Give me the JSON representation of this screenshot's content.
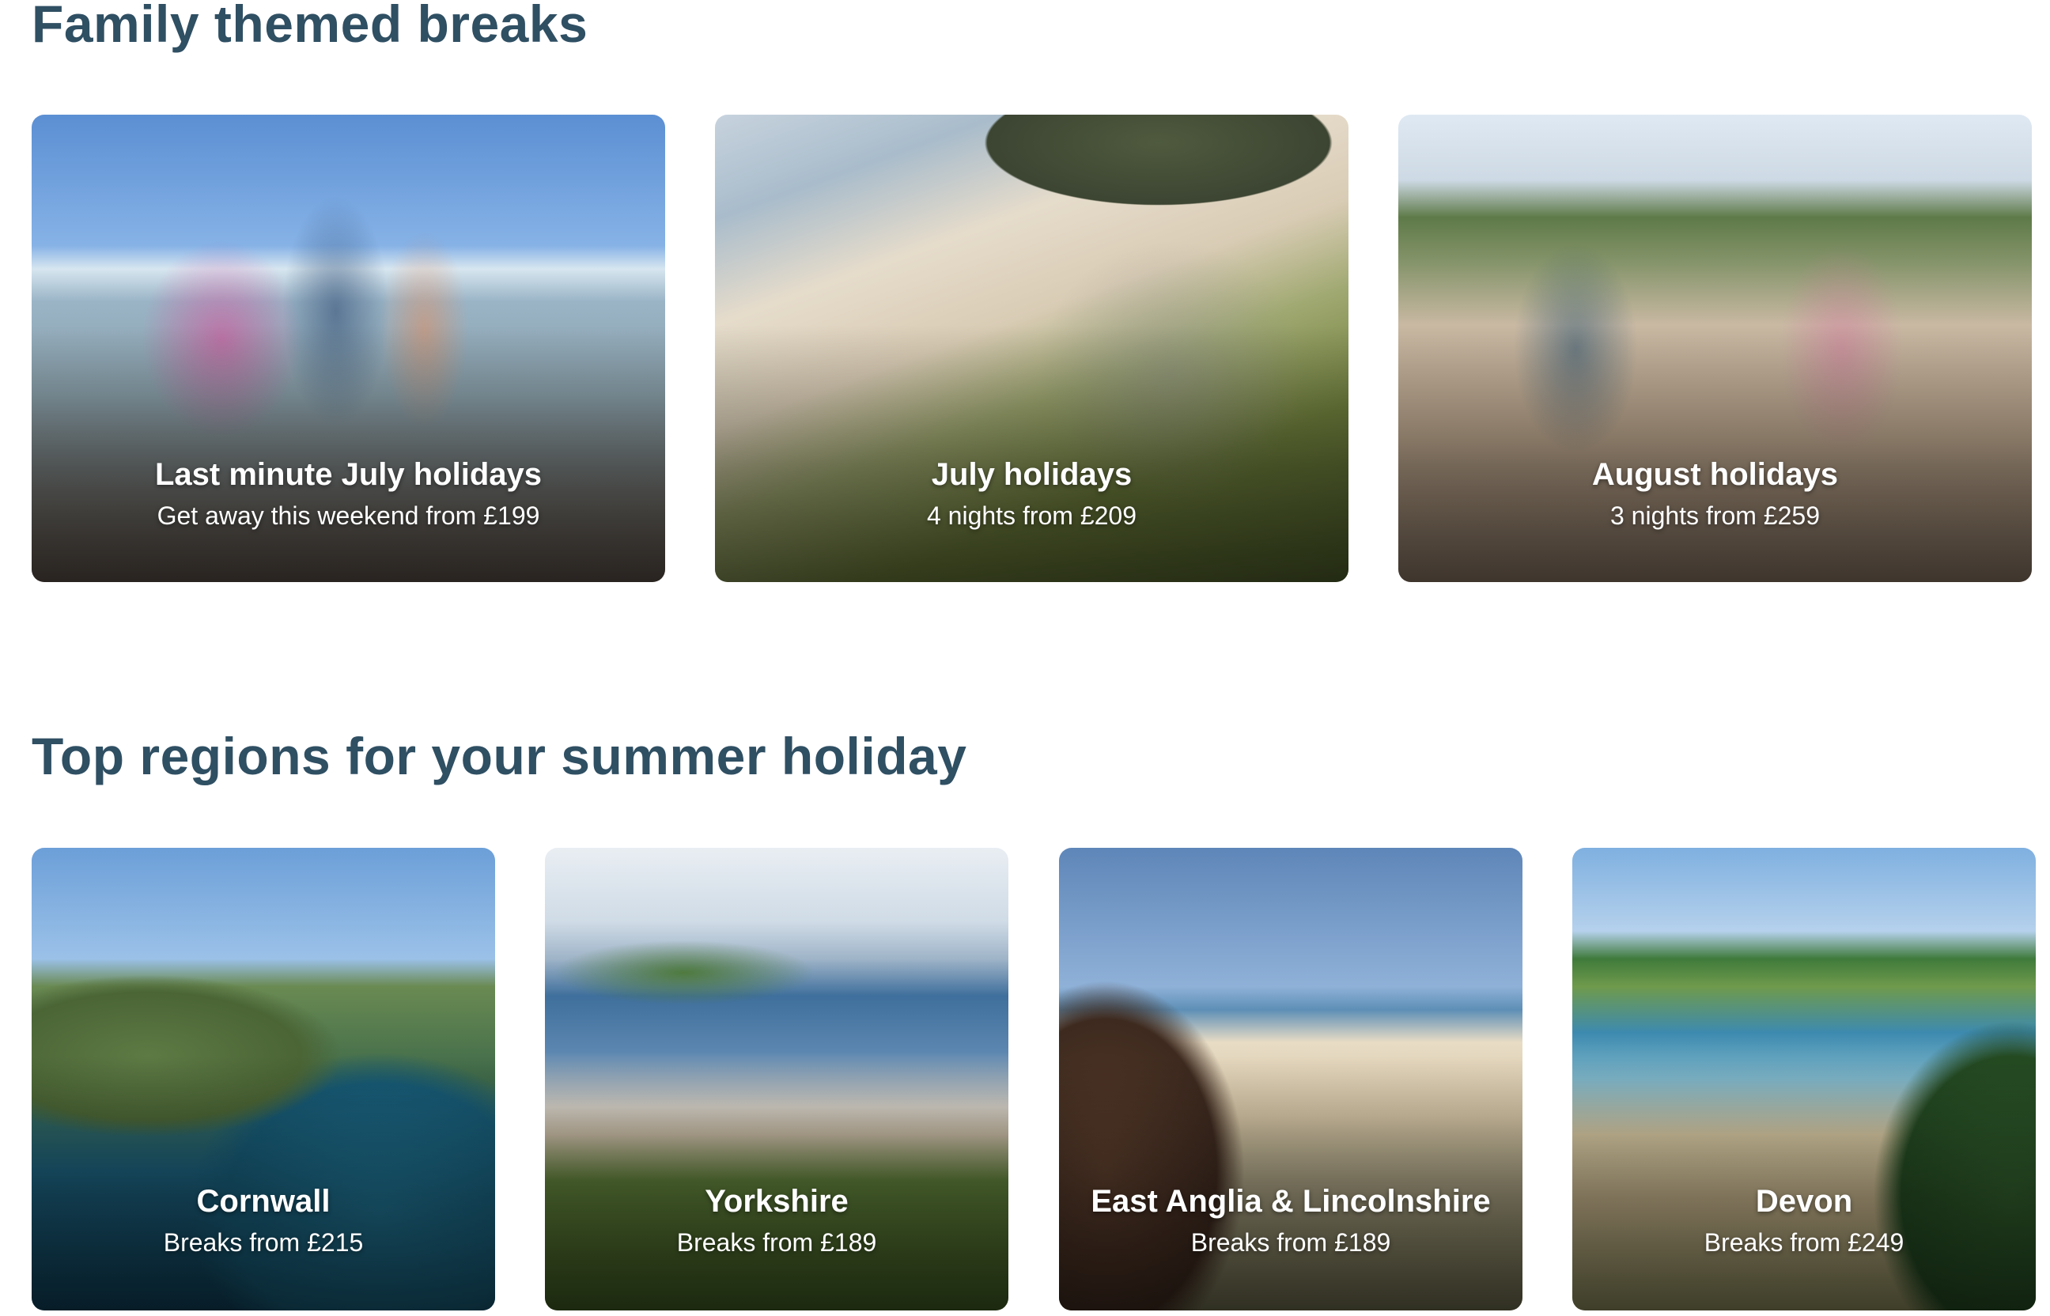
{
  "sections": {
    "family": {
      "title": "Family themed breaks",
      "cards": [
        {
          "title": "Last minute July holidays",
          "subtitle": "Get away this weekend from £199"
        },
        {
          "title": "July holidays",
          "subtitle": "4 nights from £209"
        },
        {
          "title": "August holidays",
          "subtitle": "3 nights from £259"
        }
      ]
    },
    "regions": {
      "title": "Top regions for your summer holiday",
      "cards": [
        {
          "title": "Cornwall",
          "subtitle": "Breaks from £215"
        },
        {
          "title": "Yorkshire",
          "subtitle": "Breaks from £189"
        },
        {
          "title": "East Anglia & Lincolnshire",
          "subtitle": "Breaks from £189"
        },
        {
          "title": "Devon",
          "subtitle": "Breaks from £249"
        }
      ]
    }
  },
  "colors": {
    "heading": "#2f4f63",
    "card_text": "#ffffff",
    "background": "#ffffff"
  }
}
